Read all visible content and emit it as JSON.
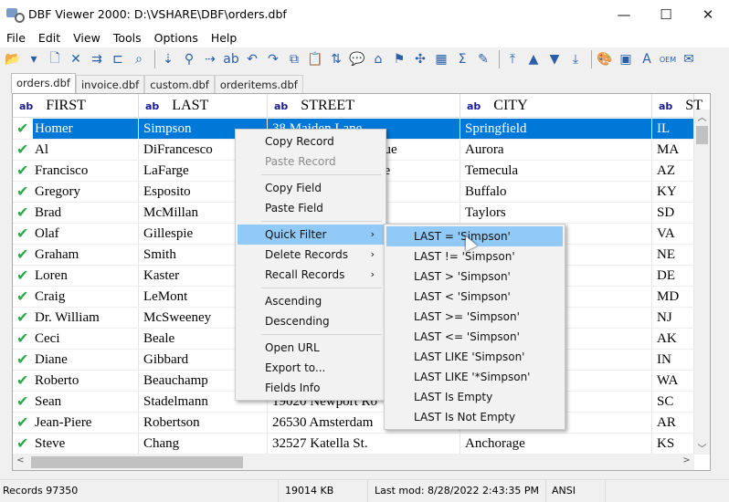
{
  "window": {
    "title": "DBF Viewer 2000: D:\\VSHARE\\DBF\\orders.dbf",
    "minimize": "—",
    "maximize": "☐",
    "close": "✕"
  },
  "menubar": [
    "File",
    "Edit",
    "View",
    "Tools",
    "Options",
    "Help"
  ],
  "toolbar": [
    [
      "open-folder-icon",
      "📂"
    ],
    [
      "dropdown-icon",
      "▾"
    ],
    [
      "new-file-icon",
      "🗋"
    ],
    [
      "delete-icon",
      "✕"
    ],
    [
      "insert-record-icon",
      "⇉"
    ],
    [
      "structure-icon",
      "⊏"
    ],
    [
      "find-icon",
      "⌕"
    ],
    "sep",
    [
      "goto-icon",
      "⇣"
    ],
    [
      "binoculars-icon",
      "⚲"
    ],
    [
      "find-next-icon",
      "⇢"
    ],
    [
      "replace-icon",
      "ab"
    ],
    [
      "undo-icon",
      "↶"
    ],
    [
      "redo-icon",
      "↷"
    ],
    [
      "copy-icon",
      "⧉"
    ],
    [
      "paste-icon",
      "📋"
    ],
    [
      "sort-icon",
      "⇅"
    ],
    [
      "comment-icon",
      "💬"
    ],
    [
      "import-icon",
      "⌂"
    ],
    [
      "filter-icon",
      "⚑"
    ],
    [
      "unfilter-icon",
      "✣"
    ],
    [
      "table-icon",
      "▦"
    ],
    [
      "sum-icon",
      "Σ"
    ],
    [
      "clean-icon",
      "✎"
    ],
    "sep",
    [
      "first-record-icon",
      "⤒"
    ],
    [
      "prev-record-icon",
      "▲"
    ],
    [
      "next-record-icon",
      "▼"
    ],
    [
      "last-record-icon",
      "⤓"
    ],
    "sep",
    [
      "palette-icon",
      "🎨"
    ],
    [
      "highlight-icon",
      "▣"
    ],
    [
      "font-icon",
      "A"
    ],
    [
      "oem-icon",
      "OEM"
    ],
    [
      "export-icon",
      "✉"
    ]
  ],
  "tabs": [
    "orders.dbf",
    "invoice.dbf",
    "custom.dbf",
    "orderitems.dbf"
  ],
  "columns": [
    {
      "type": "ab",
      "name": "FIRST"
    },
    {
      "type": "ab",
      "name": "LAST"
    },
    {
      "type": "ab",
      "name": "STREET"
    },
    {
      "type": "ab",
      "name": "CITY"
    },
    {
      "type": "ab",
      "name": "ST"
    }
  ],
  "rows": [
    [
      "Homer",
      "Simpson",
      "38 Maiden Lane",
      "Springfield",
      "IL"
    ],
    [
      "Al",
      "DiFrancesco",
      "nue",
      "Aurora",
      "MA"
    ],
    [
      "Francisco",
      "LaFarge",
      "ne",
      "Temecula",
      "AZ"
    ],
    [
      "Gregory",
      "Esposito",
      "",
      "Buffalo",
      "KY"
    ],
    [
      "Brad",
      "McMillan",
      "t.",
      "Taylors",
      "SD"
    ],
    [
      "Olaf",
      "Gillespie",
      "",
      "",
      "VA"
    ],
    [
      "Graham",
      "Smith",
      "",
      "",
      "NE"
    ],
    [
      "Loren",
      "Kaster",
      "",
      "",
      "DE"
    ],
    [
      "Craig",
      "LeMont",
      "",
      "",
      "MD"
    ],
    [
      "Dr. William",
      "McSweeney",
      "",
      "",
      "NJ"
    ],
    [
      "Ceci",
      "Beale",
      "",
      "",
      "AK"
    ],
    [
      "Diane",
      "Gibbard",
      "",
      "",
      "IN"
    ],
    [
      "Roberto",
      "Beauchamp",
      "",
      "",
      "WA"
    ],
    [
      "Sean",
      "Stadelmann",
      "19020 Newport Ro",
      "",
      "SC"
    ],
    [
      "Jean-Piere",
      "Robertson",
      "26530 Amsterdam",
      "",
      "AR"
    ],
    [
      "Steve",
      "Chang",
      "32527 Katella St.",
      "Anchorage",
      "KS"
    ]
  ],
  "selected_row": 0,
  "status": {
    "records": "Records 97350",
    "size": "19014 KB",
    "modified": "Last mod: 8/28/2022 2:43:35 PM",
    "encoding": "ANSI"
  },
  "context_menu": [
    {
      "label": "Copy Record"
    },
    {
      "label": "Paste Record",
      "disabled": true
    },
    "sep",
    {
      "label": "Copy Field"
    },
    {
      "label": "Paste Field"
    },
    "sep",
    {
      "label": "Quick Filter",
      "submenu": true,
      "highlighted": true
    },
    {
      "label": "Delete Records",
      "submenu": true
    },
    {
      "label": "Recall Records",
      "submenu": true
    },
    "sep",
    {
      "label": "Ascending"
    },
    {
      "label": "Descending"
    },
    "sep",
    {
      "label": "Open URL"
    },
    {
      "label": "Export to..."
    },
    {
      "label": "Fields Info"
    }
  ],
  "submenu": [
    "LAST = 'Simpson'",
    "LAST != 'Simpson'",
    "LAST > 'Simpson'",
    "LAST < 'Simpson'",
    "LAST >= 'Simpson'",
    "LAST <= 'Simpson'",
    "LAST LIKE 'Simpson'",
    "LAST LIKE '*Simpson'",
    "LAST Is Empty",
    "LAST Is Not Empty"
  ],
  "submenu_highlighted": 0,
  "colors": {
    "selection": "#0078d7",
    "menu_highlight": "#91c9f7",
    "check": "#2aa84a"
  }
}
